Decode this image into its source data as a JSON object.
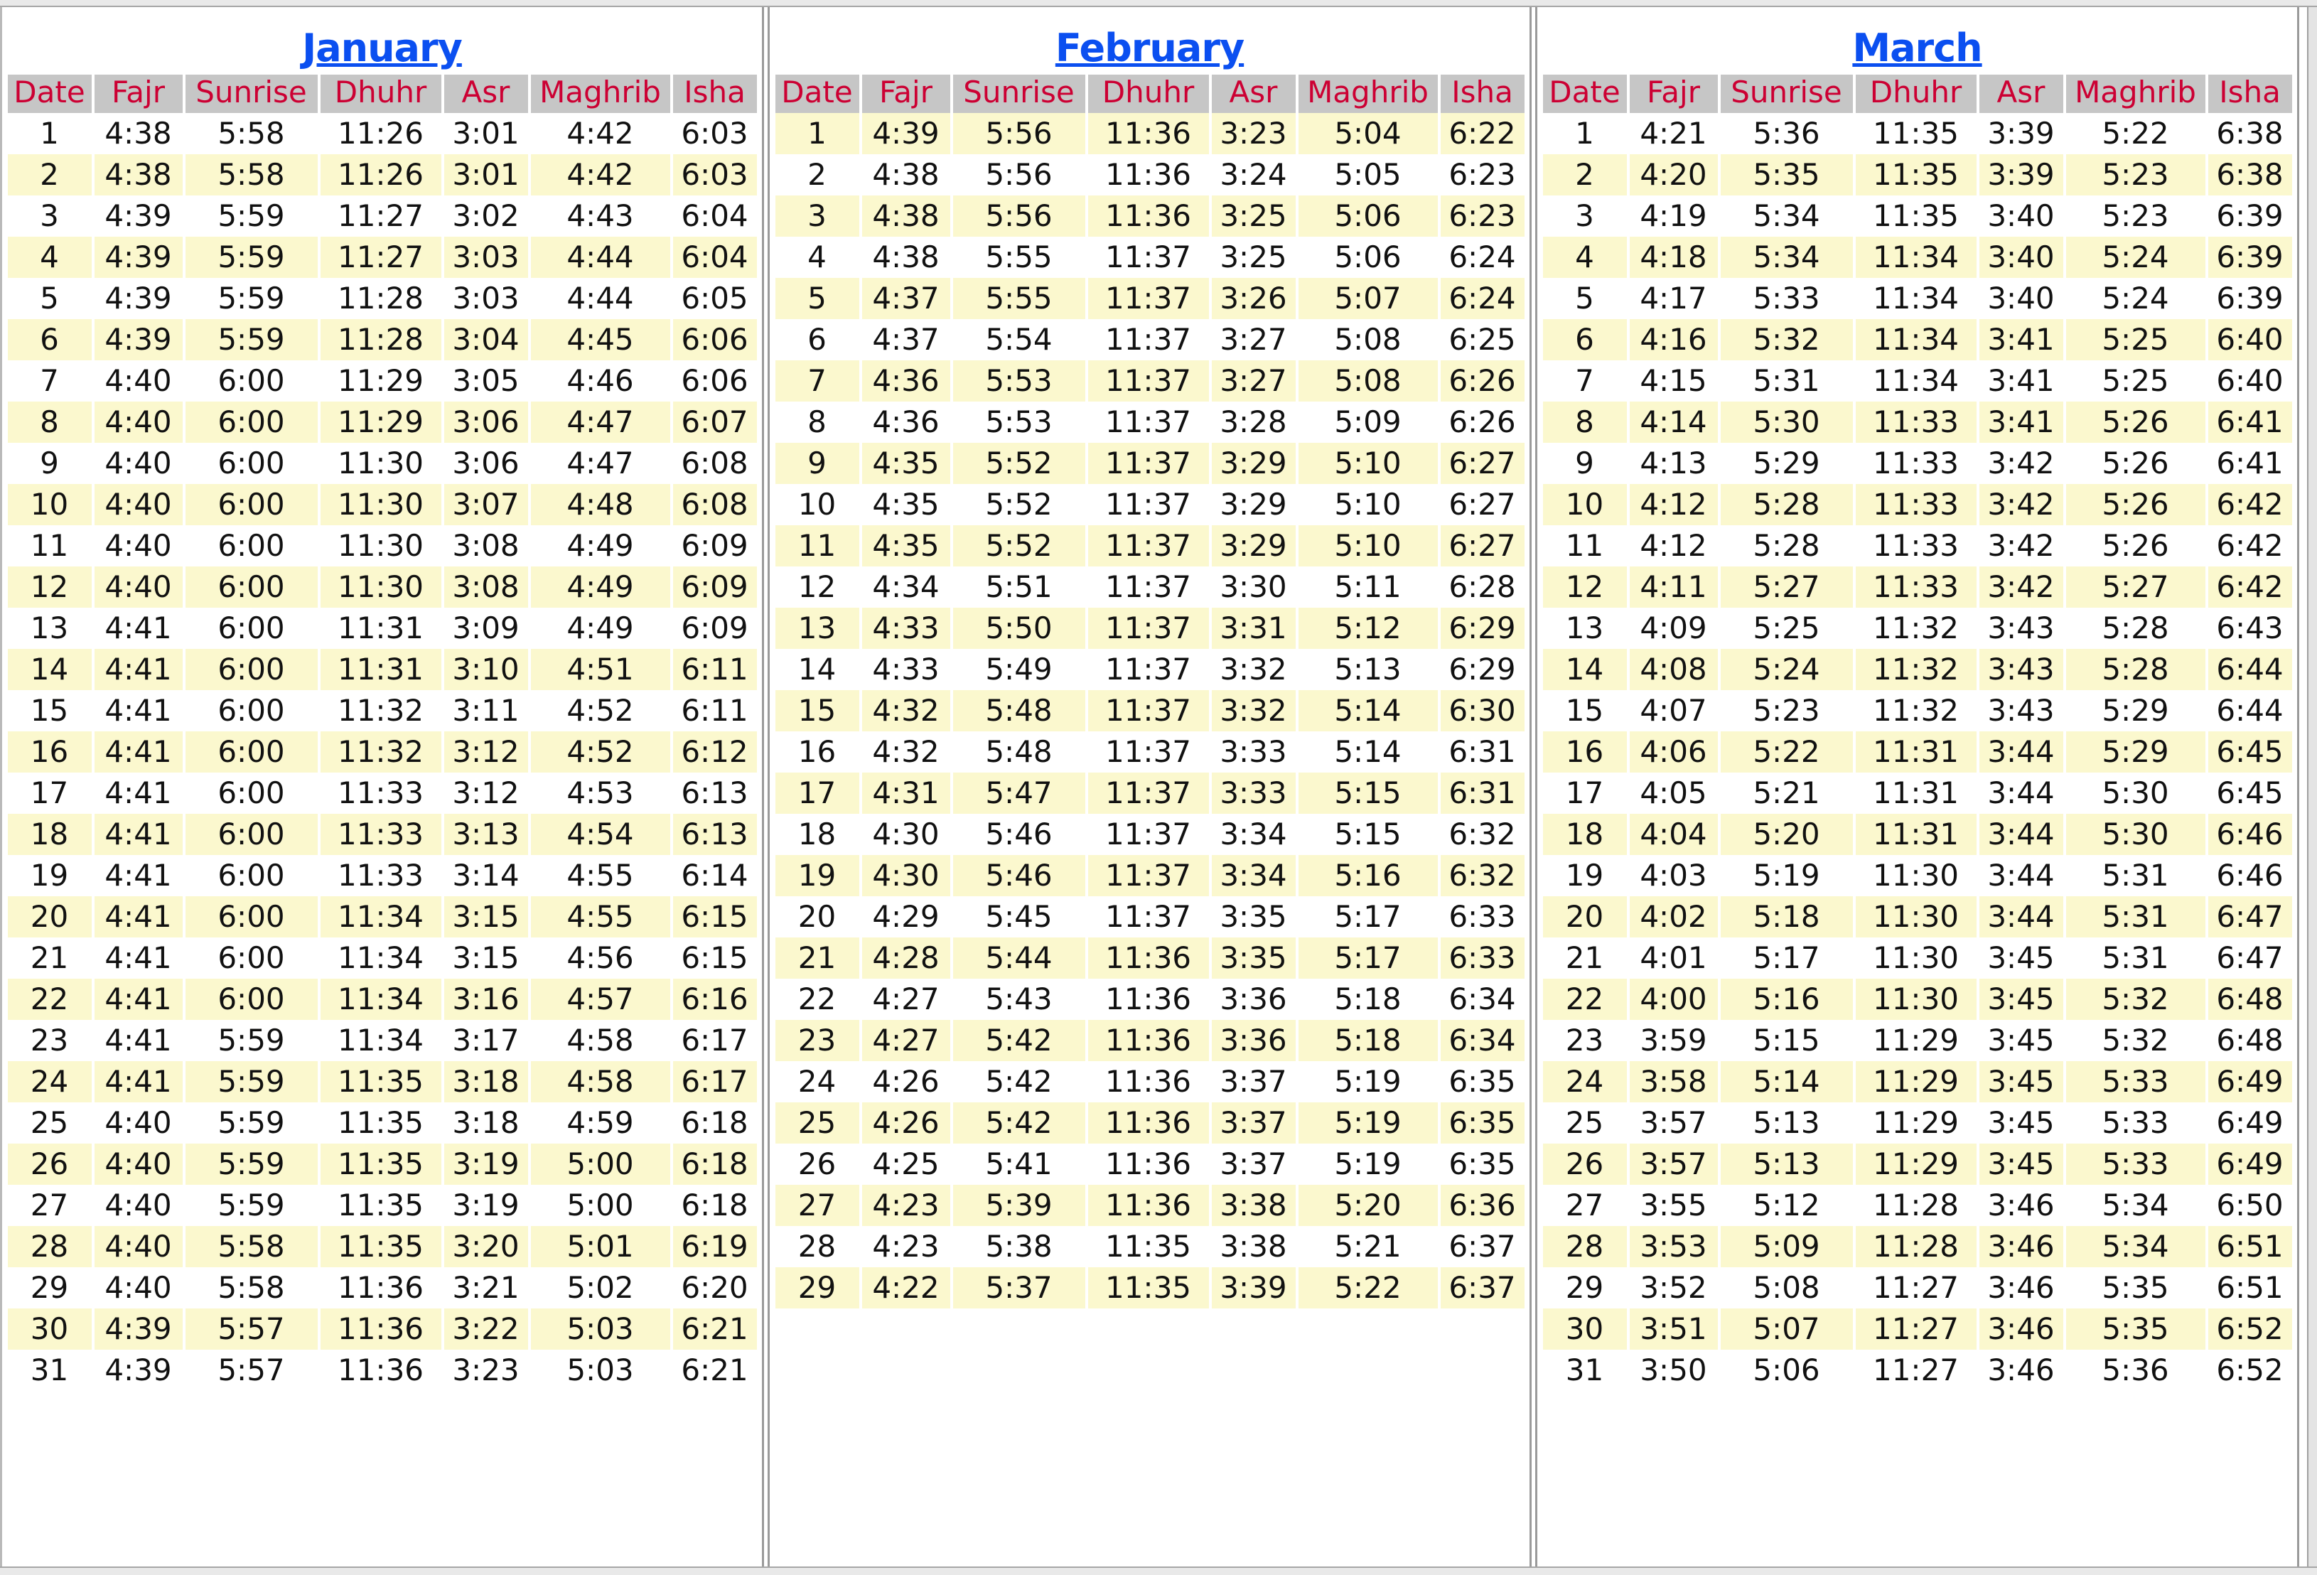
{
  "colors": {
    "title": "#0b4ff0",
    "header_text": "#cc0033",
    "header_bg": "#c6c6c6",
    "row_shade": "#fbf8ce",
    "row_plain": "#ffffff",
    "cell_text": "#111111"
  },
  "columns": [
    "Date",
    "Fajr",
    "Sunrise",
    "Dhuhr",
    "Asr",
    "Maghrib",
    "Isha"
  ],
  "months": [
    {
      "title": "January",
      "shade_parity": "even",
      "rows": [
        [
          "1",
          "4:38",
          "5:58",
          "11:26",
          "3:01",
          "4:42",
          "6:03"
        ],
        [
          "2",
          "4:38",
          "5:58",
          "11:26",
          "3:01",
          "4:42",
          "6:03"
        ],
        [
          "3",
          "4:39",
          "5:59",
          "11:27",
          "3:02",
          "4:43",
          "6:04"
        ],
        [
          "4",
          "4:39",
          "5:59",
          "11:27",
          "3:03",
          "4:44",
          "6:04"
        ],
        [
          "5",
          "4:39",
          "5:59",
          "11:28",
          "3:03",
          "4:44",
          "6:05"
        ],
        [
          "6",
          "4:39",
          "5:59",
          "11:28",
          "3:04",
          "4:45",
          "6:06"
        ],
        [
          "7",
          "4:40",
          "6:00",
          "11:29",
          "3:05",
          "4:46",
          "6:06"
        ],
        [
          "8",
          "4:40",
          "6:00",
          "11:29",
          "3:06",
          "4:47",
          "6:07"
        ],
        [
          "9",
          "4:40",
          "6:00",
          "11:30",
          "3:06",
          "4:47",
          "6:08"
        ],
        [
          "10",
          "4:40",
          "6:00",
          "11:30",
          "3:07",
          "4:48",
          "6:08"
        ],
        [
          "11",
          "4:40",
          "6:00",
          "11:30",
          "3:08",
          "4:49",
          "6:09"
        ],
        [
          "12",
          "4:40",
          "6:00",
          "11:30",
          "3:08",
          "4:49",
          "6:09"
        ],
        [
          "13",
          "4:41",
          "6:00",
          "11:31",
          "3:09",
          "4:49",
          "6:09"
        ],
        [
          "14",
          "4:41",
          "6:00",
          "11:31",
          "3:10",
          "4:51",
          "6:11"
        ],
        [
          "15",
          "4:41",
          "6:00",
          "11:32",
          "3:11",
          "4:52",
          "6:11"
        ],
        [
          "16",
          "4:41",
          "6:00",
          "11:32",
          "3:12",
          "4:52",
          "6:12"
        ],
        [
          "17",
          "4:41",
          "6:00",
          "11:33",
          "3:12",
          "4:53",
          "6:13"
        ],
        [
          "18",
          "4:41",
          "6:00",
          "11:33",
          "3:13",
          "4:54",
          "6:13"
        ],
        [
          "19",
          "4:41",
          "6:00",
          "11:33",
          "3:14",
          "4:55",
          "6:14"
        ],
        [
          "20",
          "4:41",
          "6:00",
          "11:34",
          "3:15",
          "4:55",
          "6:15"
        ],
        [
          "21",
          "4:41",
          "6:00",
          "11:34",
          "3:15",
          "4:56",
          "6:15"
        ],
        [
          "22",
          "4:41",
          "6:00",
          "11:34",
          "3:16",
          "4:57",
          "6:16"
        ],
        [
          "23",
          "4:41",
          "5:59",
          "11:34",
          "3:17",
          "4:58",
          "6:17"
        ],
        [
          "24",
          "4:41",
          "5:59",
          "11:35",
          "3:18",
          "4:58",
          "6:17"
        ],
        [
          "25",
          "4:40",
          "5:59",
          "11:35",
          "3:18",
          "4:59",
          "6:18"
        ],
        [
          "26",
          "4:40",
          "5:59",
          "11:35",
          "3:19",
          "5:00",
          "6:18"
        ],
        [
          "27",
          "4:40",
          "5:59",
          "11:35",
          "3:19",
          "5:00",
          "6:18"
        ],
        [
          "28",
          "4:40",
          "5:58",
          "11:35",
          "3:20",
          "5:01",
          "6:19"
        ],
        [
          "29",
          "4:40",
          "5:58",
          "11:36",
          "3:21",
          "5:02",
          "6:20"
        ],
        [
          "30",
          "4:39",
          "5:57",
          "11:36",
          "3:22",
          "5:03",
          "6:21"
        ],
        [
          "31",
          "4:39",
          "5:57",
          "11:36",
          "3:23",
          "5:03",
          "6:21"
        ]
      ]
    },
    {
      "title": "February",
      "shade_parity": "odd",
      "rows": [
        [
          "1",
          "4:39",
          "5:56",
          "11:36",
          "3:23",
          "5:04",
          "6:22"
        ],
        [
          "2",
          "4:38",
          "5:56",
          "11:36",
          "3:24",
          "5:05",
          "6:23"
        ],
        [
          "3",
          "4:38",
          "5:56",
          "11:36",
          "3:25",
          "5:06",
          "6:23"
        ],
        [
          "4",
          "4:38",
          "5:55",
          "11:37",
          "3:25",
          "5:06",
          "6:24"
        ],
        [
          "5",
          "4:37",
          "5:55",
          "11:37",
          "3:26",
          "5:07",
          "6:24"
        ],
        [
          "6",
          "4:37",
          "5:54",
          "11:37",
          "3:27",
          "5:08",
          "6:25"
        ],
        [
          "7",
          "4:36",
          "5:53",
          "11:37",
          "3:27",
          "5:08",
          "6:26"
        ],
        [
          "8",
          "4:36",
          "5:53",
          "11:37",
          "3:28",
          "5:09",
          "6:26"
        ],
        [
          "9",
          "4:35",
          "5:52",
          "11:37",
          "3:29",
          "5:10",
          "6:27"
        ],
        [
          "10",
          "4:35",
          "5:52",
          "11:37",
          "3:29",
          "5:10",
          "6:27"
        ],
        [
          "11",
          "4:35",
          "5:52",
          "11:37",
          "3:29",
          "5:10",
          "6:27"
        ],
        [
          "12",
          "4:34",
          "5:51",
          "11:37",
          "3:30",
          "5:11",
          "6:28"
        ],
        [
          "13",
          "4:33",
          "5:50",
          "11:37",
          "3:31",
          "5:12",
          "6:29"
        ],
        [
          "14",
          "4:33",
          "5:49",
          "11:37",
          "3:32",
          "5:13",
          "6:29"
        ],
        [
          "15",
          "4:32",
          "5:48",
          "11:37",
          "3:32",
          "5:14",
          "6:30"
        ],
        [
          "16",
          "4:32",
          "5:48",
          "11:37",
          "3:33",
          "5:14",
          "6:31"
        ],
        [
          "17",
          "4:31",
          "5:47",
          "11:37",
          "3:33",
          "5:15",
          "6:31"
        ],
        [
          "18",
          "4:30",
          "5:46",
          "11:37",
          "3:34",
          "5:15",
          "6:32"
        ],
        [
          "19",
          "4:30",
          "5:46",
          "11:37",
          "3:34",
          "5:16",
          "6:32"
        ],
        [
          "20",
          "4:29",
          "5:45",
          "11:37",
          "3:35",
          "5:17",
          "6:33"
        ],
        [
          "21",
          "4:28",
          "5:44",
          "11:36",
          "3:35",
          "5:17",
          "6:33"
        ],
        [
          "22",
          "4:27",
          "5:43",
          "11:36",
          "3:36",
          "5:18",
          "6:34"
        ],
        [
          "23",
          "4:27",
          "5:42",
          "11:36",
          "3:36",
          "5:18",
          "6:34"
        ],
        [
          "24",
          "4:26",
          "5:42",
          "11:36",
          "3:37",
          "5:19",
          "6:35"
        ],
        [
          "25",
          "4:26",
          "5:42",
          "11:36",
          "3:37",
          "5:19",
          "6:35"
        ],
        [
          "26",
          "4:25",
          "5:41",
          "11:36",
          "3:37",
          "5:19",
          "6:35"
        ],
        [
          "27",
          "4:23",
          "5:39",
          "11:36",
          "3:38",
          "5:20",
          "6:36"
        ],
        [
          "28",
          "4:23",
          "5:38",
          "11:35",
          "3:38",
          "5:21",
          "6:37"
        ],
        [
          "29",
          "4:22",
          "5:37",
          "11:35",
          "3:39",
          "5:22",
          "6:37"
        ]
      ]
    },
    {
      "title": "March",
      "shade_parity": "even",
      "rows": [
        [
          "1",
          "4:21",
          "5:36",
          "11:35",
          "3:39",
          "5:22",
          "6:38"
        ],
        [
          "2",
          "4:20",
          "5:35",
          "11:35",
          "3:39",
          "5:23",
          "6:38"
        ],
        [
          "3",
          "4:19",
          "5:34",
          "11:35",
          "3:40",
          "5:23",
          "6:39"
        ],
        [
          "4",
          "4:18",
          "5:34",
          "11:34",
          "3:40",
          "5:24",
          "6:39"
        ],
        [
          "5",
          "4:17",
          "5:33",
          "11:34",
          "3:40",
          "5:24",
          "6:39"
        ],
        [
          "6",
          "4:16",
          "5:32",
          "11:34",
          "3:41",
          "5:25",
          "6:40"
        ],
        [
          "7",
          "4:15",
          "5:31",
          "11:34",
          "3:41",
          "5:25",
          "6:40"
        ],
        [
          "8",
          "4:14",
          "5:30",
          "11:33",
          "3:41",
          "5:26",
          "6:41"
        ],
        [
          "9",
          "4:13",
          "5:29",
          "11:33",
          "3:42",
          "5:26",
          "6:41"
        ],
        [
          "10",
          "4:12",
          "5:28",
          "11:33",
          "3:42",
          "5:26",
          "6:42"
        ],
        [
          "11",
          "4:12",
          "5:28",
          "11:33",
          "3:42",
          "5:26",
          "6:42"
        ],
        [
          "12",
          "4:11",
          "5:27",
          "11:33",
          "3:42",
          "5:27",
          "6:42"
        ],
        [
          "13",
          "4:09",
          "5:25",
          "11:32",
          "3:43",
          "5:28",
          "6:43"
        ],
        [
          "14",
          "4:08",
          "5:24",
          "11:32",
          "3:43",
          "5:28",
          "6:44"
        ],
        [
          "15",
          "4:07",
          "5:23",
          "11:32",
          "3:43",
          "5:29",
          "6:44"
        ],
        [
          "16",
          "4:06",
          "5:22",
          "11:31",
          "3:44",
          "5:29",
          "6:45"
        ],
        [
          "17",
          "4:05",
          "5:21",
          "11:31",
          "3:44",
          "5:30",
          "6:45"
        ],
        [
          "18",
          "4:04",
          "5:20",
          "11:31",
          "3:44",
          "5:30",
          "6:46"
        ],
        [
          "19",
          "4:03",
          "5:19",
          "11:30",
          "3:44",
          "5:31",
          "6:46"
        ],
        [
          "20",
          "4:02",
          "5:18",
          "11:30",
          "3:44",
          "5:31",
          "6:47"
        ],
        [
          "21",
          "4:01",
          "5:17",
          "11:30",
          "3:45",
          "5:31",
          "6:47"
        ],
        [
          "22",
          "4:00",
          "5:16",
          "11:30",
          "3:45",
          "5:32",
          "6:48"
        ],
        [
          "23",
          "3:59",
          "5:15",
          "11:29",
          "3:45",
          "5:32",
          "6:48"
        ],
        [
          "24",
          "3:58",
          "5:14",
          "11:29",
          "3:45",
          "5:33",
          "6:49"
        ],
        [
          "25",
          "3:57",
          "5:13",
          "11:29",
          "3:45",
          "5:33",
          "6:49"
        ],
        [
          "26",
          "3:57",
          "5:13",
          "11:29",
          "3:45",
          "5:33",
          "6:49"
        ],
        [
          "27",
          "3:55",
          "5:12",
          "11:28",
          "3:46",
          "5:34",
          "6:50"
        ],
        [
          "28",
          "3:53",
          "5:09",
          "11:28",
          "3:46",
          "5:34",
          "6:51"
        ],
        [
          "29",
          "3:52",
          "5:08",
          "11:27",
          "3:46",
          "5:35",
          "6:51"
        ],
        [
          "30",
          "3:51",
          "5:07",
          "11:27",
          "3:46",
          "5:35",
          "6:52"
        ],
        [
          "31",
          "3:50",
          "5:06",
          "11:27",
          "3:46",
          "5:36",
          "6:52"
        ]
      ]
    }
  ]
}
